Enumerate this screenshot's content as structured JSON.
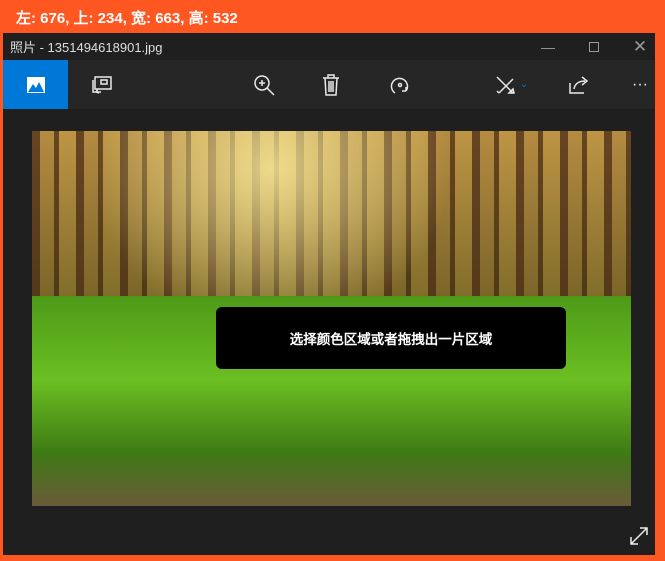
{
  "capture_info": "左: 676, 上: 234, 宽: 663, 高: 532",
  "window": {
    "title": "照片 - 1351494618901.jpg"
  },
  "toolbar": {
    "buttons": [
      "photo-view",
      "slideshow",
      "zoom-in",
      "delete",
      "rotate",
      "edit-create",
      "share",
      "more"
    ],
    "more_label": "···"
  },
  "overlay": {
    "text": "选择颜色区域或者拖拽出一片区域"
  },
  "colors": {
    "accent": "#0078d7",
    "capture_border": "#ff5722",
    "window_bg": "#1f1f1f"
  }
}
